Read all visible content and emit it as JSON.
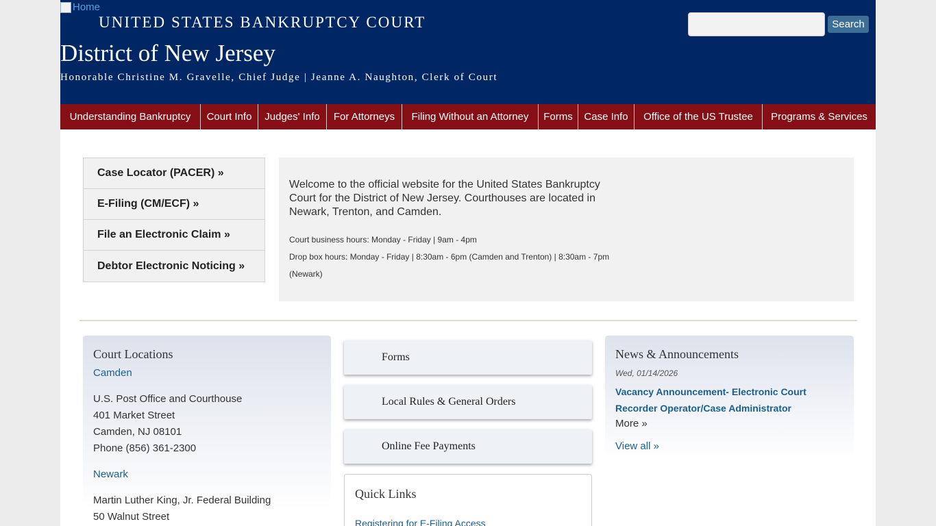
{
  "header": {
    "home_link": "Home",
    "court_name": "UNITED STATES BANKRUPTCY COURT",
    "district": "District of New Jersey",
    "officials": "Honorable Christine M. Gravelle, Chief Judge | Jeanne A. Naughton, Clerk of Court",
    "search_value": "",
    "search_button": "Search"
  },
  "nav": [
    "Understanding Bankruptcy",
    "Court Info",
    "Judges' Info",
    "For Attorneys",
    "Filing Without an Attorney",
    "Forms",
    "Case Info",
    "Office of the US Trustee",
    "Programs & Services"
  ],
  "quick_buttons": [
    "Case Locator (PACER) »",
    "E-Filing (CM/ECF) »",
    "File an Electronic Claim »",
    "Debtor Electronic Noticing »"
  ],
  "welcome": {
    "text": "Welcome to the official website for the United States Bankruptcy Court for the District of New Jersey. Courthouses are located in Newark, Trenton, and Camden.",
    "business_hours": "Court business hours: Monday - Friday | 9am - 4pm",
    "dropbox_hours": "Drop box hours: Monday - Friday | 8:30am - 6pm (Camden and Trenton) | 8:30am - 7pm (Newark)"
  },
  "court_locations": {
    "title": "Court Locations",
    "locations": [
      {
        "name": "Camden",
        "lines": [
          "U.S. Post Office and Courthouse",
          "401 Market Street",
          "Camden, NJ 08101",
          "Phone (856) 361-2300"
        ]
      },
      {
        "name": "Newark",
        "lines": [
          "Martin Luther King, Jr. Federal Building",
          "50 Walnut Street"
        ]
      }
    ]
  },
  "features": [
    "Forms",
    "Local Rules & General Orders",
    "Online Fee Payments"
  ],
  "quick_links": {
    "title": "Quick Links",
    "items": [
      "Registering for E-Filing Access"
    ]
  },
  "news": {
    "title": "News & Announcements",
    "date": "Wed, 01/14/2026",
    "headline": "Vacancy Announcement- Electronic Court Recorder Operator/Case Administrator",
    "more": "More »",
    "view_all": "View all »"
  }
}
